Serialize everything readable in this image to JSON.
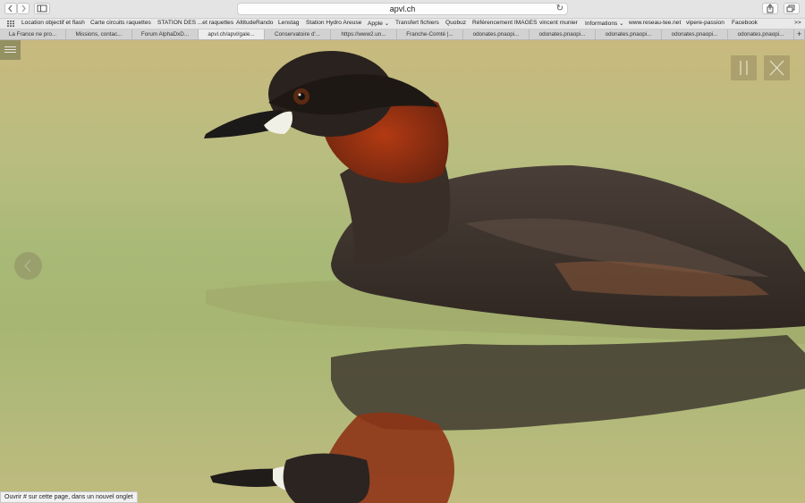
{
  "toolbar": {
    "back_icon": "chevron-left-icon",
    "forward_icon": "chevron-right-icon",
    "sidebar_icon": "sidebar-icon",
    "address": "apvl.ch",
    "reload_icon": "reload-icon",
    "share_icon": "share-icon",
    "tabs_icon": "tabs-overview-icon"
  },
  "bookmarks": {
    "items": [
      "Location objectif et flash",
      "Carte circuits raquettes",
      "STATION DES ...et raquettes",
      "AltitudeRando",
      "Lenstag",
      "Station Hydro Areuse",
      "Apple ⌄",
      "Transfert fichiers",
      "Quobuz",
      "Référencement IMAGES",
      "vincent munier",
      "Informations ⌄",
      "www.reseau-tee.net",
      "vipere-passion",
      "Facebook"
    ],
    "more": ">>"
  },
  "tabs": {
    "items": [
      "La France ne pro...",
      "Missions, contac...",
      "Forum AlphaDxD...",
      "apvl.ch/apvl/gale...",
      "Conservatoire d'...",
      "https://www2.un...",
      "Franche-Comté |...",
      "odonates.pnaopi...",
      "odonates.pnaopi...",
      "odonates.pnaopi...",
      "odonates.pnaopi...",
      "odonates.pnaopi..."
    ],
    "active_index": 3,
    "new_tab": "+"
  },
  "gallery": {
    "menu_icon": "hamburger-menu-icon",
    "pause_icon": "pause-icon",
    "close_icon": "close-icon",
    "prev_icon": "chevron-left-icon",
    "photo_subject": "little-grebe-photo"
  },
  "status_bar": {
    "text": "Ouvrir # sur cette page, dans un nouvel onglet"
  }
}
